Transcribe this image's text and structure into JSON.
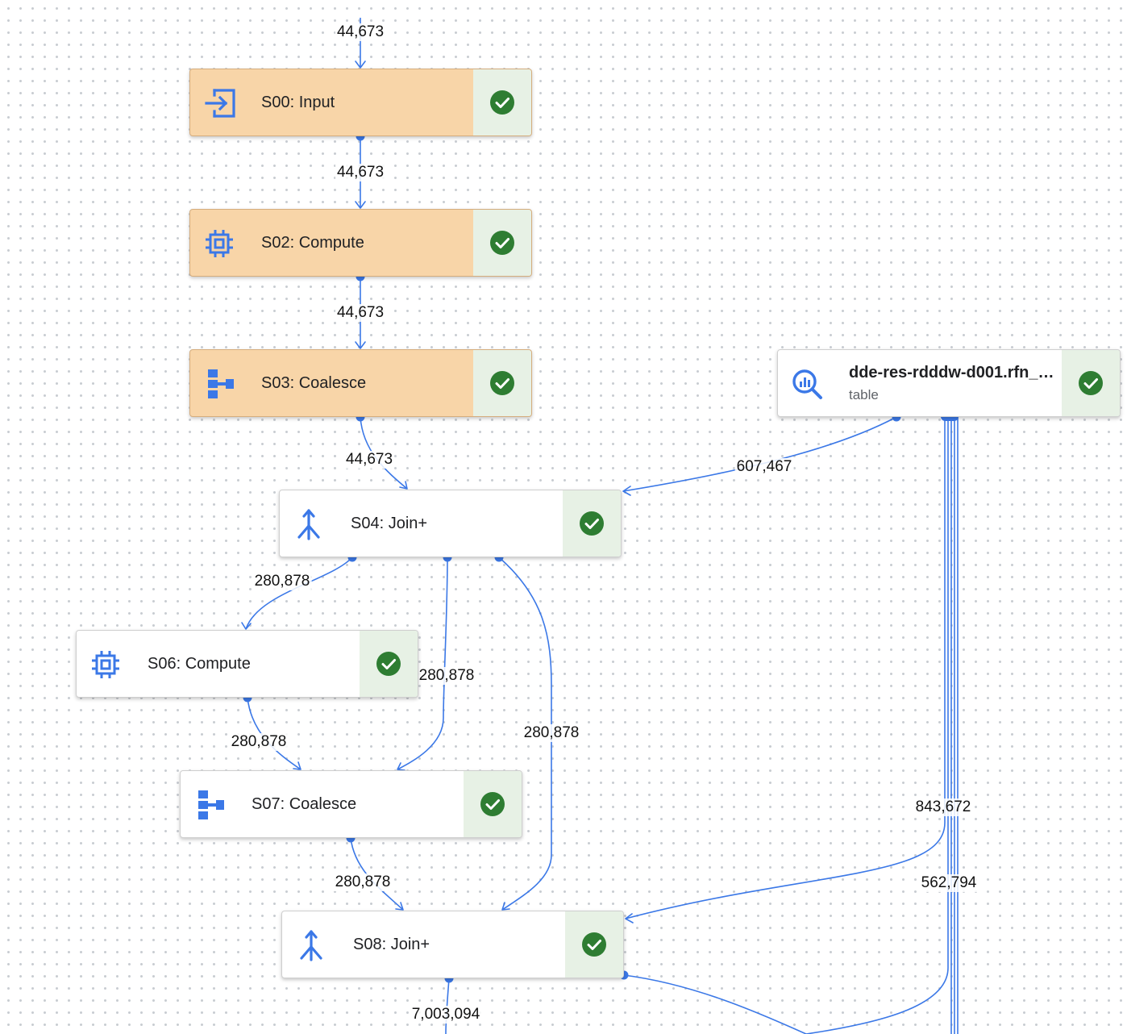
{
  "colors": {
    "edge": "#3b78e7",
    "icon": "#3b78e7",
    "node_highlight_bg": "#f8d5a8",
    "node_bg": "#ffffff",
    "status_bg": "#e7f1e5",
    "success": "#2e7d32"
  },
  "nodes": [
    {
      "id": "s00",
      "title": "S00: Input",
      "icon": "input-icon",
      "highlighted": true,
      "status": "success"
    },
    {
      "id": "s02",
      "title": "S02: Compute",
      "icon": "chip-icon",
      "highlighted": true,
      "status": "success"
    },
    {
      "id": "s03",
      "title": "S03: Coalesce",
      "icon": "coalesce-icon",
      "highlighted": true,
      "status": "success"
    },
    {
      "id": "table",
      "title": "dde-res-rdddw-d001.rfn_…",
      "subtitle": "table",
      "icon": "bigquery-search-icon",
      "highlighted": false,
      "status": "success"
    },
    {
      "id": "s04",
      "title": "S04: Join+",
      "icon": "merge-icon",
      "highlighted": false,
      "status": "success"
    },
    {
      "id": "s06",
      "title": "S06: Compute",
      "icon": "chip-icon",
      "highlighted": false,
      "status": "success"
    },
    {
      "id": "s07",
      "title": "S07: Coalesce",
      "icon": "coalesce-icon",
      "highlighted": false,
      "status": "success"
    },
    {
      "id": "s08",
      "title": "S08: Join+",
      "icon": "merge-icon",
      "highlighted": false,
      "status": "success"
    }
  ],
  "edge_labels": {
    "into_s00": "44,673",
    "s00_to_s02": "44,673",
    "s02_to_s03": "44,673",
    "s03_to_s04": "44,673",
    "table_to_s04": "607,467",
    "s04_to_s06": "280,878",
    "s04_to_s07": "280,878",
    "s04_to_s08": "280,878",
    "s06_to_s07": "280,878",
    "s07_to_s08": "280,878",
    "table_to_s08": "843,672",
    "table_out_2": "562,794",
    "s08_out": "7,003,094"
  }
}
